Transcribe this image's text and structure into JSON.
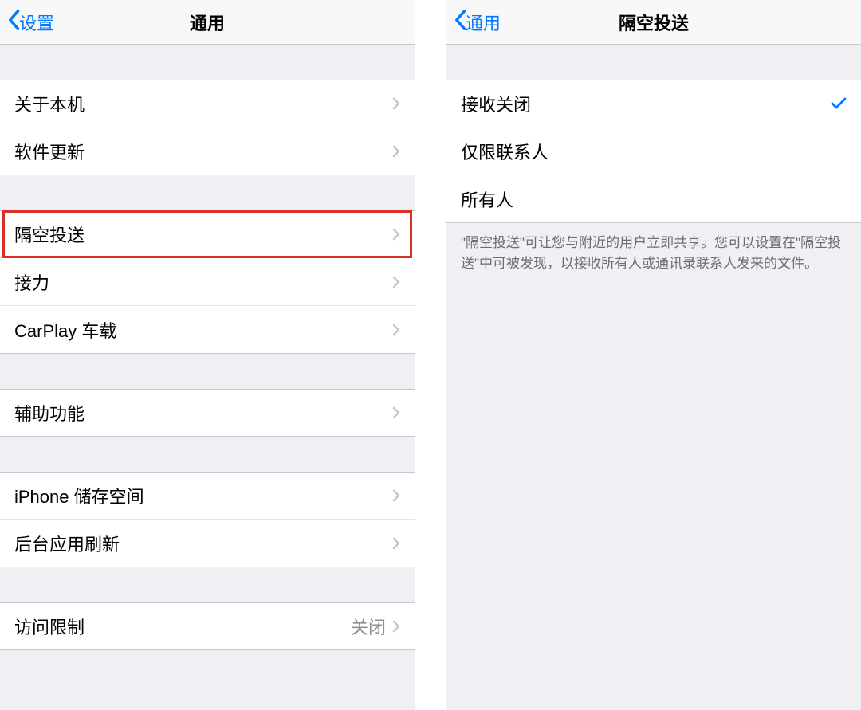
{
  "panelLeft": {
    "backLabel": "设置",
    "title": "通用",
    "rows": {
      "about": "关于本机",
      "softwareUpdate": "软件更新",
      "airdrop": "隔空投送",
      "handoff": "接力",
      "carplay": "CarPlay 车载",
      "accessibility": "辅助功能",
      "storage": "iPhone 储存空间",
      "backgroundRefresh": "后台应用刷新",
      "restrictions": "访问限制",
      "restrictionsValue": "关闭"
    }
  },
  "panelRight": {
    "backLabel": "通用",
    "title": "隔空投送",
    "options": {
      "off": "接收关闭",
      "contactsOnly": "仅限联系人",
      "everyone": "所有人"
    },
    "footer": "\"隔空投送\"可让您与附近的用户立即共享。您可以设置在\"隔空投送\"中可被发现，以接收所有人或通讯录联系人发来的文件。"
  }
}
